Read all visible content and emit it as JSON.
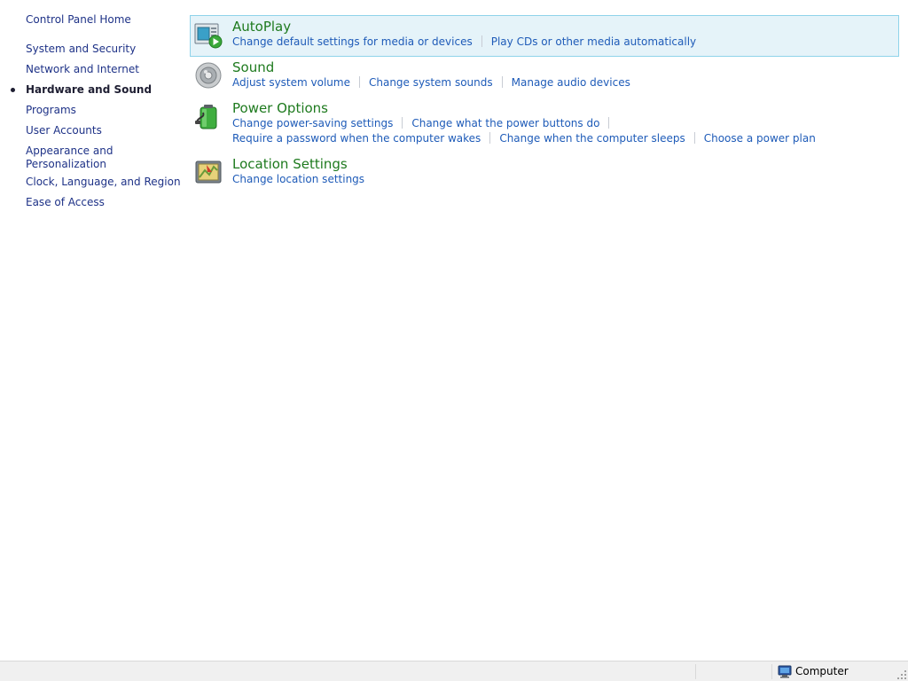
{
  "sidebar": {
    "home_label": "Control Panel Home",
    "items": [
      {
        "label": "System and Security"
      },
      {
        "label": "Network and Internet"
      },
      {
        "label": "Hardware and Sound"
      },
      {
        "label": "Programs"
      },
      {
        "label": "User Accounts"
      },
      {
        "label": "Appearance and\nPersonalization"
      },
      {
        "label": "Clock, Language, and Region"
      },
      {
        "label": "Ease of Access"
      }
    ],
    "active_index": 2
  },
  "categories": [
    {
      "title": "AutoPlay",
      "icon": "autoplay-icon",
      "links": [
        "Change default settings for media or devices",
        "Play CDs or other media automatically"
      ]
    },
    {
      "title": "Sound",
      "icon": "speaker-icon",
      "links": [
        "Adjust system volume",
        "Change system sounds",
        "Manage audio devices"
      ]
    },
    {
      "title": "Power Options",
      "icon": "battery-icon",
      "links_row1": [
        "Change power-saving settings",
        "Change what the power buttons do"
      ],
      "links_row2": [
        "Require a password when the computer wakes",
        "Change when the computer sleeps",
        "Choose a power plan"
      ]
    },
    {
      "title": "Location Settings",
      "icon": "location-icon",
      "links": [
        "Change location settings"
      ]
    }
  ],
  "statusbar": {
    "text": "Computer",
    "icon": "computer-icon"
  }
}
